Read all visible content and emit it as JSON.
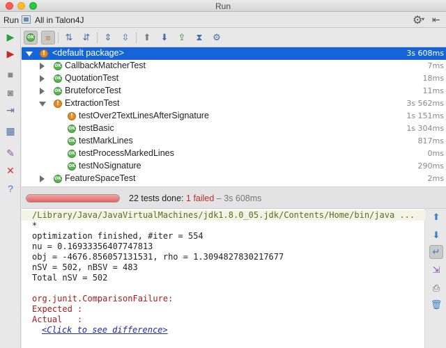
{
  "window": {
    "title": "Run"
  },
  "runbar": {
    "label": "Run",
    "config_name": "All in Talon4J"
  },
  "tree": {
    "rows": [
      {
        "label": "<default package>",
        "time": "3s 608ms",
        "status": "fail",
        "expanded": true
      },
      {
        "label": "CallbackMatcherTest",
        "time": "7ms",
        "status": "ok",
        "expanded": false
      },
      {
        "label": "QuotationTest",
        "time": "18ms",
        "status": "ok",
        "expanded": false
      },
      {
        "label": "BruteforceTest",
        "time": "11ms",
        "status": "ok",
        "expanded": false
      },
      {
        "label": "ExtractionTest",
        "time": "3s 562ms",
        "status": "fail",
        "expanded": true
      },
      {
        "label": "testOver2TextLinesAfterSignature",
        "time": "1s 151ms",
        "status": "fail"
      },
      {
        "label": "testBasic",
        "time": "1s 304ms",
        "status": "ok"
      },
      {
        "label": "testMarkLines",
        "time": "817ms",
        "status": "ok"
      },
      {
        "label": "testProcessMarkedLines",
        "time": "0ms",
        "status": "ok"
      },
      {
        "label": "testNoSignature",
        "time": "290ms",
        "status": "ok"
      },
      {
        "label": "FeatureSpaceTest",
        "time": "2ms",
        "status": "ok",
        "expanded": false
      }
    ]
  },
  "status": {
    "done_text": "22 tests done: ",
    "failed_text": "1 failed",
    "time_text": " – 3s 608ms",
    "progress": 1.0
  },
  "console": {
    "lines": [
      "/Library/Java/JavaVirtualMachines/jdk1.8.0_05.jdk/Contents/Home/bin/java ...",
      "*",
      "optimization finished, #iter = 554",
      "nu = 0.16933356407747813",
      "obj = -4676.856057131531, rho = 1.3094827830217677",
      "nSV = 502, nBSV = 483",
      "Total nSV = 502",
      "",
      "org.junit.ComparisonFailure:",
      "Expected :",
      "Actual   :",
      "<Click to see difference>"
    ]
  },
  "badges": {
    "ok": "OK",
    "fail": "!"
  },
  "colors": {
    "selection": "#1565d8",
    "ok": "#5ab552",
    "fail": "#e38b26",
    "failed_text": "#c62828"
  }
}
